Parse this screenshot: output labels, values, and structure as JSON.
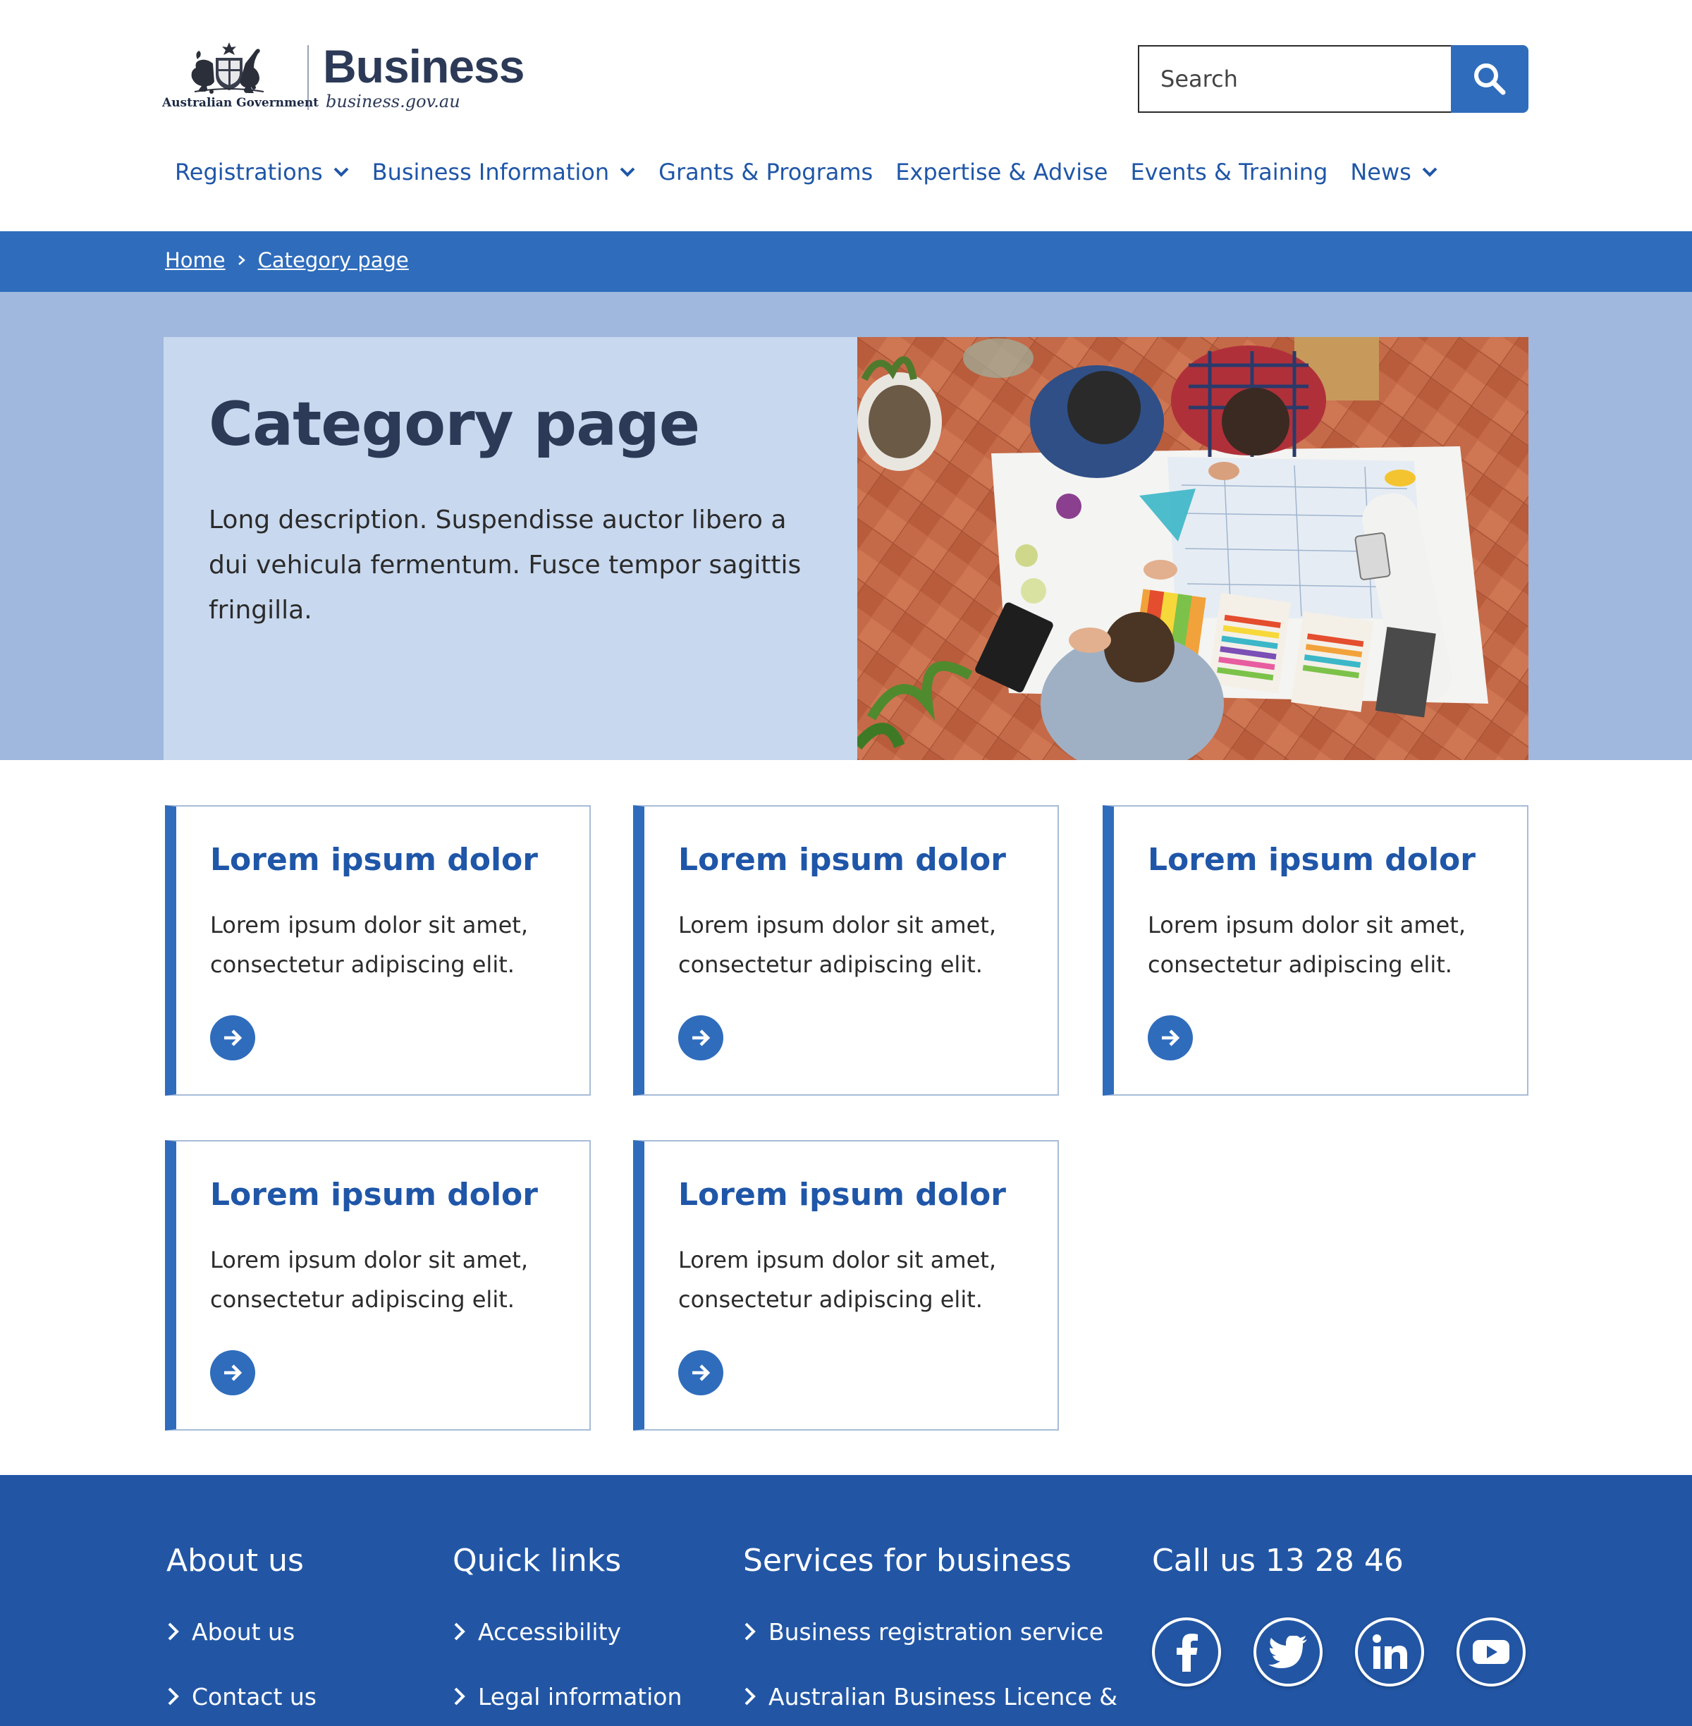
{
  "header": {
    "gov_caption": "Australian Government",
    "brand_name": "Business",
    "brand_url": "business.gov.au",
    "search_placeholder": "Search"
  },
  "nav": {
    "items": [
      {
        "label": "Registrations",
        "has_dropdown": true
      },
      {
        "label": "Business Information",
        "has_dropdown": true
      },
      {
        "label": "Grants & Programs",
        "has_dropdown": false
      },
      {
        "label": "Expertise & Advise",
        "has_dropdown": false
      },
      {
        "label": "Events & Training",
        "has_dropdown": false
      },
      {
        "label": "News",
        "has_dropdown": true
      }
    ]
  },
  "breadcrumb": {
    "home": "Home",
    "current": "Category page"
  },
  "hero": {
    "title": "Category page",
    "description": "Long description. Suspendisse auctor libero a dui vehicula fermentum. Fusce tempor sagittis fringilla."
  },
  "cards": [
    {
      "title": "Lorem ipsum dolor",
      "text": " Lorem ipsum dolor sit amet, consectetur adipiscing elit."
    },
    {
      "title": "Lorem ipsum dolor",
      "text": " Lorem ipsum dolor sit amet, consectetur adipiscing elit."
    },
    {
      "title": "Lorem ipsum dolor",
      "text": " Lorem ipsum dolor sit amet, consectetur adipiscing elit."
    },
    {
      "title": "Lorem ipsum dolor",
      "text": " Lorem ipsum dolor sit amet, consectetur adipiscing elit."
    },
    {
      "title": "Lorem ipsum dolor",
      "text": " Lorem ipsum dolor sit amet, consectetur adipiscing elit."
    }
  ],
  "footer": {
    "about": {
      "heading": "About us",
      "links": [
        "About us",
        "Contact us"
      ]
    },
    "quick": {
      "heading": "Quick links",
      "links": [
        "Accessibility",
        "Legal information"
      ]
    },
    "services": {
      "heading": "Services for business",
      "links": [
        "Business registration service",
        "Australian Business Licence &"
      ]
    },
    "call": {
      "heading": "Call us 13 28 46"
    },
    "social_icons": [
      "facebook-icon",
      "twitter-icon",
      "linkedin-icon",
      "youtube-icon"
    ]
  },
  "colors": {
    "primary": "#2f6cbc",
    "link": "#1f56a8",
    "heading_dark": "#2c3a57",
    "hero_band": "#a0b8de",
    "hero_card": "#c8d8ee",
    "footer": "#2256a5"
  }
}
